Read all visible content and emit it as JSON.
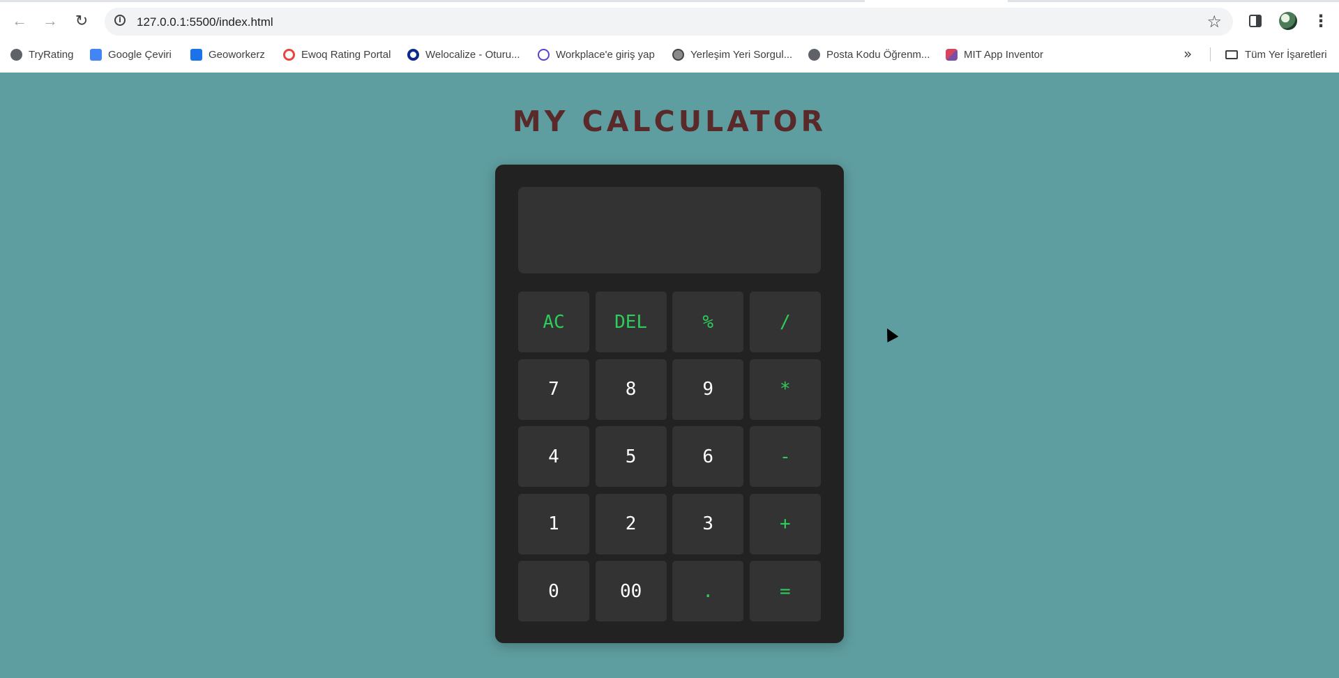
{
  "browser": {
    "url": "127.0.0.1:5500/index.html",
    "bookmarks": [
      {
        "label": "TryRating",
        "icon": "globe-icon"
      },
      {
        "label": "Google Çeviri",
        "icon": "google-translate-icon"
      },
      {
        "label": "Geoworkerz",
        "icon": "sharepoint-icon"
      },
      {
        "label": "Ewoq Rating Portal",
        "icon": "ewoq-icon"
      },
      {
        "label": "Welocalize - Oturu...",
        "icon": "welocalize-icon"
      },
      {
        "label": "Workplace'e giriş yap",
        "icon": "workplace-icon"
      },
      {
        "label": "Yerleşim Yeri Sorgul...",
        "icon": "yerlesim-icon"
      },
      {
        "label": "Posta Kodu Öğrenm...",
        "icon": "globe-icon"
      },
      {
        "label": "MIT App Inventor",
        "icon": "mit-app-inventor-icon"
      }
    ],
    "all_bookmarks_label": "Tüm Yer İşaretleri"
  },
  "page": {
    "title": "MY CALCULATOR"
  },
  "calculator": {
    "display_value": "",
    "keys": [
      {
        "label": "AC",
        "type": "op"
      },
      {
        "label": "DEL",
        "type": "op"
      },
      {
        "label": "%",
        "type": "op"
      },
      {
        "label": "/",
        "type": "op"
      },
      {
        "label": "7",
        "type": "num"
      },
      {
        "label": "8",
        "type": "num"
      },
      {
        "label": "9",
        "type": "num"
      },
      {
        "label": "*",
        "type": "op"
      },
      {
        "label": "4",
        "type": "num"
      },
      {
        "label": "5",
        "type": "num"
      },
      {
        "label": "6",
        "type": "num"
      },
      {
        "label": "-",
        "type": "op"
      },
      {
        "label": "1",
        "type": "num"
      },
      {
        "label": "2",
        "type": "num"
      },
      {
        "label": "3",
        "type": "num"
      },
      {
        "label": "+",
        "type": "op"
      },
      {
        "label": "0",
        "type": "num"
      },
      {
        "label": "00",
        "type": "num"
      },
      {
        "label": ".",
        "type": "op"
      },
      {
        "label": "=",
        "type": "op"
      }
    ]
  },
  "colors": {
    "page_background": "#5f9ea0",
    "title": "#5a2a2a",
    "calculator_body": "#222222",
    "key_background": "#333333",
    "operator_text": "#2ecc5b",
    "digit_text": "#ffffff"
  }
}
